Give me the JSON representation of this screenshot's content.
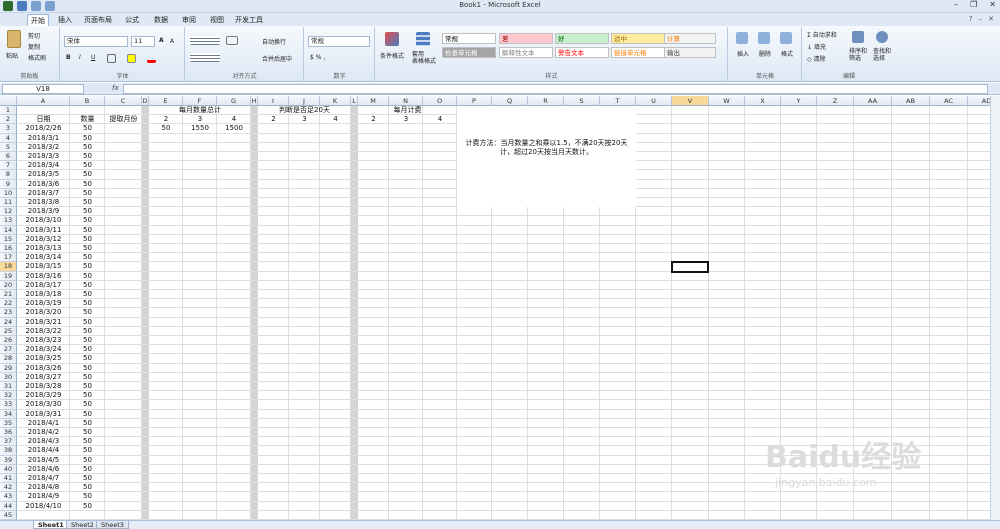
{
  "window": {
    "title": "Book1 - Microsoft Excel",
    "minimize": "–",
    "restore": "❐",
    "close": "✕"
  },
  "ribbon_tabs": [
    "开始",
    "插入",
    "页面布局",
    "公式",
    "数据",
    "审阅",
    "视图",
    "开发工具"
  ],
  "ribbon": {
    "clipboard": {
      "paste": "粘贴",
      "cut": "剪切",
      "copy": "复制",
      "format_painter": "格式刷",
      "label": "剪贴板"
    },
    "font": {
      "name": "宋体",
      "size": "11",
      "bold": "B",
      "italic": "I",
      "underline": "U",
      "grow": "A",
      "shrink": "A",
      "label": "字体"
    },
    "alignment": {
      "wrap": "自动换行",
      "merge": "合并后居中",
      "label": "对齐方式"
    },
    "number": {
      "format": "常规",
      "label": "数字"
    },
    "styles": {
      "conditional": "条件格式",
      "table": "套用\n表格格式",
      "cells": [
        {
          "text": "常规",
          "bg": "#ffffff",
          "fg": "#000000"
        },
        {
          "text": "差",
          "bg": "#ffc7ce",
          "fg": "#9c0006"
        },
        {
          "text": "好",
          "bg": "#c6efce",
          "fg": "#006100"
        },
        {
          "text": "适中",
          "bg": "#ffeb9c",
          "fg": "#9c6500"
        },
        {
          "text": "计算",
          "bg": "#f2f2f2",
          "fg": "#fa7d00"
        },
        {
          "text": "检查单元格",
          "bg": "#a5a5a5",
          "fg": "#ffffff"
        },
        {
          "text": "解释性文本",
          "bg": "#ffffff",
          "fg": "#7f7f7f"
        },
        {
          "text": "警告文本",
          "bg": "#ffffff",
          "fg": "#ff0000"
        },
        {
          "text": "链接单元格",
          "bg": "#ffffff",
          "fg": "#fa7d00"
        },
        {
          "text": "输出",
          "bg": "#f2f2f2",
          "fg": "#3f3f3f"
        }
      ],
      "label": "样式"
    },
    "cells_group": {
      "insert": "插入",
      "delete": "删除",
      "format": "格式",
      "label": "单元格"
    },
    "editing": {
      "autosum": "自动求和",
      "fill": "填充",
      "clear": "清除",
      "sort": "排序和\n筛选",
      "find": "查找和\n选择",
      "label": "编辑"
    }
  },
  "formula_bar": {
    "name_box": "V18",
    "fx": "fx",
    "value": ""
  },
  "columns": [
    "A",
    "B",
    "C",
    "D",
    "E",
    "F",
    "G",
    "H",
    "I",
    "J",
    "K",
    "L",
    "M",
    "N",
    "O",
    "P",
    "Q",
    "R",
    "S",
    "T",
    "U",
    "V",
    "W",
    "X",
    "Y",
    "Z",
    "AA",
    "AB",
    "AC",
    "AD"
  ],
  "selected_column": "V",
  "selected_row": 18,
  "headers": {
    "date": "日期",
    "qty": "数量",
    "month": "提取月份",
    "monthly_total": "每月数量总计",
    "over20": "判断是否足20天",
    "monthly_fee": "每月计费"
  },
  "month_labels_1": [
    "2",
    "3",
    "4"
  ],
  "month_totals": [
    "50",
    "1550",
    "1500"
  ],
  "month_labels_2": [
    "2",
    "3",
    "4"
  ],
  "month_labels_3": [
    "2",
    "3",
    "4"
  ],
  "note": "计费方法：当月数量之和乘以1.5，不满20天按20天计，超过20天按当月天数计。",
  "rows": [
    [
      "2018/2/26",
      "50"
    ],
    [
      "2018/3/1",
      "50"
    ],
    [
      "2018/3/2",
      "50"
    ],
    [
      "2018/3/3",
      "50"
    ],
    [
      "2018/3/4",
      "50"
    ],
    [
      "2018/3/5",
      "50"
    ],
    [
      "2018/3/6",
      "50"
    ],
    [
      "2018/3/7",
      "50"
    ],
    [
      "2018/3/8",
      "50"
    ],
    [
      "2018/3/9",
      "50"
    ],
    [
      "2018/3/10",
      "50"
    ],
    [
      "2018/3/11",
      "50"
    ],
    [
      "2018/3/12",
      "50"
    ],
    [
      "2018/3/13",
      "50"
    ],
    [
      "2018/3/14",
      "50"
    ],
    [
      "2018/3/15",
      "50"
    ],
    [
      "2018/3/16",
      "50"
    ],
    [
      "2018/3/17",
      "50"
    ],
    [
      "2018/3/18",
      "50"
    ],
    [
      "2018/3/19",
      "50"
    ],
    [
      "2018/3/20",
      "50"
    ],
    [
      "2018/3/21",
      "50"
    ],
    [
      "2018/3/22",
      "50"
    ],
    [
      "2018/3/23",
      "50"
    ],
    [
      "2018/3/24",
      "50"
    ],
    [
      "2018/3/25",
      "50"
    ],
    [
      "2018/3/26",
      "50"
    ],
    [
      "2018/3/27",
      "50"
    ],
    [
      "2018/3/28",
      "50"
    ],
    [
      "2018/3/29",
      "50"
    ],
    [
      "2018/3/30",
      "50"
    ],
    [
      "2018/3/31",
      "50"
    ],
    [
      "2018/4/1",
      "50"
    ],
    [
      "2018/4/2",
      "50"
    ],
    [
      "2018/4/3",
      "50"
    ],
    [
      "2018/4/4",
      "50"
    ],
    [
      "2018/4/5",
      "50"
    ],
    [
      "2018/4/6",
      "50"
    ],
    [
      "2018/4/7",
      "50"
    ],
    [
      "2018/4/8",
      "50"
    ],
    [
      "2018/4/9",
      "50"
    ],
    [
      "2018/4/10",
      "50"
    ]
  ],
  "sheets": [
    "Sheet1",
    "Sheet2",
    "Sheet3"
  ],
  "watermark": {
    "brand": "Baidu经验",
    "url": "jingyan.baidu.com"
  }
}
